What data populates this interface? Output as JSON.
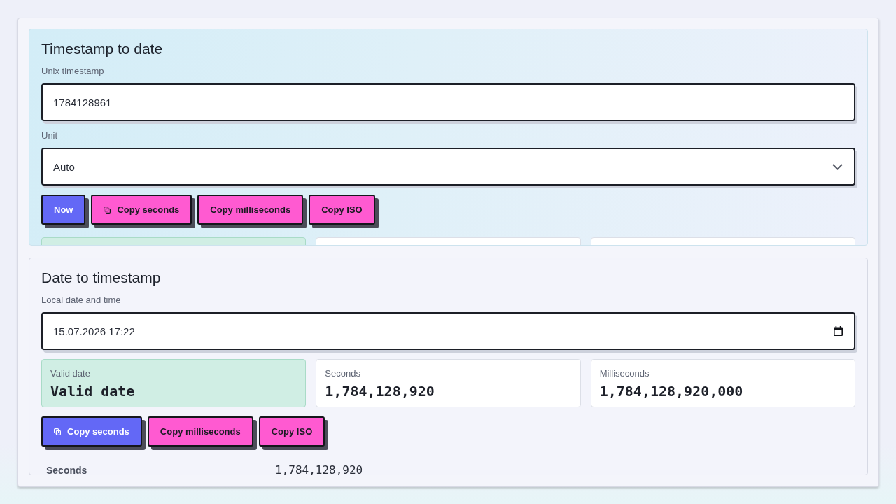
{
  "panels": [
    {
      "title": "Timestamp to date",
      "blocks": [
        {
          "kind": "input",
          "label": "Unix timestamp",
          "value": "1784128961"
        },
        {
          "kind": "select",
          "label": "Unit",
          "value": "Auto"
        },
        {
          "kind": "buttons",
          "items": [
            {
              "label": "Now",
              "kind": "primary",
              "with_icon": false
            },
            {
              "label": "Copy seconds",
              "kind": "secondary",
              "with_icon": true
            },
            {
              "label": "Copy milliseconds",
              "kind": "secondary",
              "with_icon": false
            },
            {
              "label": "Copy ISO",
              "kind": "secondary",
              "with_icon": false
            }
          ]
        },
        {
          "kind": "cards",
          "items": [
            {
              "kind": "status"
            },
            {
              "kind": "number"
            },
            {
              "kind": "number"
            }
          ]
        }
      ]
    },
    {
      "title": "Date to timestamp",
      "blocks": [
        {
          "kind": "datetime",
          "label": "Local date and time",
          "value": "15.07.2026 17:22"
        },
        {
          "kind": "cards",
          "items": [
            {
              "kind": "status",
              "label": "Valid date",
              "value": "Valid date"
            },
            {
              "kind": "number",
              "label": "Seconds",
              "value": "1,784,128,920"
            },
            {
              "kind": "number",
              "label": "Milliseconds",
              "value": "1,784,128,920,000"
            }
          ]
        },
        {
          "kind": "buttons",
          "items": [
            {
              "label": "Copy seconds",
              "kind": "primary",
              "with_icon": true
            },
            {
              "label": "Copy milliseconds",
              "kind": "secondary",
              "with_icon": false
            },
            {
              "label": "Copy ISO",
              "kind": "secondary",
              "with_icon": false
            }
          ]
        },
        {
          "kind": "details",
          "items": [
            {
              "label": "Seconds",
              "value": "1,784,128,920"
            }
          ]
        }
      ]
    }
  ]
}
